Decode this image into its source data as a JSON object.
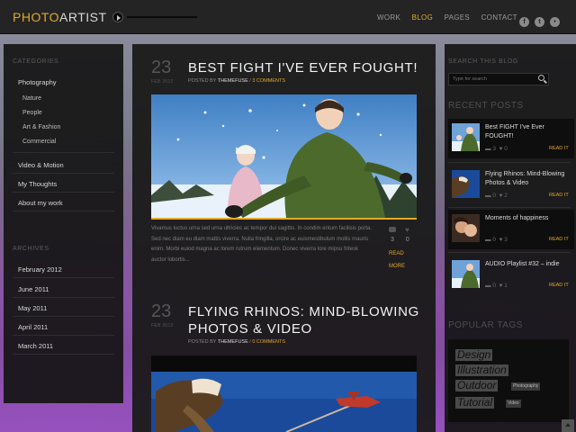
{
  "header": {
    "logo_part1": "PHOTO",
    "logo_part2": "ARTIST",
    "nav": [
      {
        "label": "WORK",
        "active": false
      },
      {
        "label": "BLOG",
        "active": true
      },
      {
        "label": "PAGES",
        "active": false
      },
      {
        "label": "CONTACT",
        "active": false
      }
    ],
    "social": [
      {
        "icon": "facebook-icon",
        "glyph": "f"
      },
      {
        "icon": "twitter-icon",
        "glyph": "t"
      },
      {
        "icon": "flickr-icon",
        "glyph": "•"
      }
    ]
  },
  "left_sidebar": {
    "categories_title": "CATEGORIES",
    "categories": [
      {
        "label": "Photography",
        "children": [
          "Nature",
          "People",
          "Art & Fashion",
          "Commercial"
        ]
      },
      {
        "label": "Video & Motion",
        "children": []
      },
      {
        "label": "My Thoughts",
        "children": []
      },
      {
        "label": "About my work",
        "children": []
      }
    ],
    "archives_title": "ARCHIVES",
    "archives": [
      "February 2012",
      "June 2011",
      "May 2011",
      "April 2011",
      "March 2011"
    ]
  },
  "posts": [
    {
      "day": "23",
      "month_year": "FEB 2012",
      "title": "BEST FIGHT I'VE EVER FOUGHT!",
      "meta_prefix": "POSTED BY",
      "author": "THEMEFUSE",
      "comments": "3 COMMENTS",
      "excerpt": "Vivamus luctus urna sed urna ultricies ac tempor dui sagittis. In condim entum facilisis porta. Sed nec diam eu diam mattis viverra. Nulla fringilla, orcire ac euismestibulum mollis mauris enim. Morbi euiod magna ac lorem rutrum elementum. Donec viverra lore mipsu fritesk auctor lobortis...",
      "comment_count": "3",
      "like_count": "0",
      "read_more": "READ MORE"
    },
    {
      "day": "23",
      "month_year": "FEB 2012",
      "title_line1": "FLYING RHINOS: MIND-BLOWING",
      "title_line2": "PHOTOS & VIDEO",
      "meta_prefix": "POSTED BY",
      "author": "THEMEFUSE",
      "comments": "0 COMMENTS"
    }
  ],
  "right_sidebar": {
    "search_title": "SEARCH THIS BLOG",
    "search_placeholder": "Type for search",
    "recent_title": "RECENT POSTS",
    "recent_posts": [
      {
        "title": "Best FIGHT I've Ever FOUGHT!",
        "comments": "3",
        "likes": "0",
        "read": "READ IT"
      },
      {
        "title": "Flying Rhinos: Mind-Blowing Photos & Video",
        "comments": "0",
        "likes": "2",
        "read": "READ IT"
      },
      {
        "title": "Moments of happiness",
        "comments": "0",
        "likes": "3",
        "read": "READ IT"
      },
      {
        "title": "AUDIO Playlist #32 – indie",
        "comments": "0",
        "likes": "1",
        "read": "READ IT"
      }
    ],
    "tags_title": "POPULAR TAGS",
    "tags": [
      "Design",
      "Illustration",
      "Outdoor",
      "Photography",
      "Tutorial",
      "Video"
    ]
  },
  "colors": {
    "accent": "#e3a92b",
    "panel": "#1a1a1a",
    "header": "#242424"
  }
}
